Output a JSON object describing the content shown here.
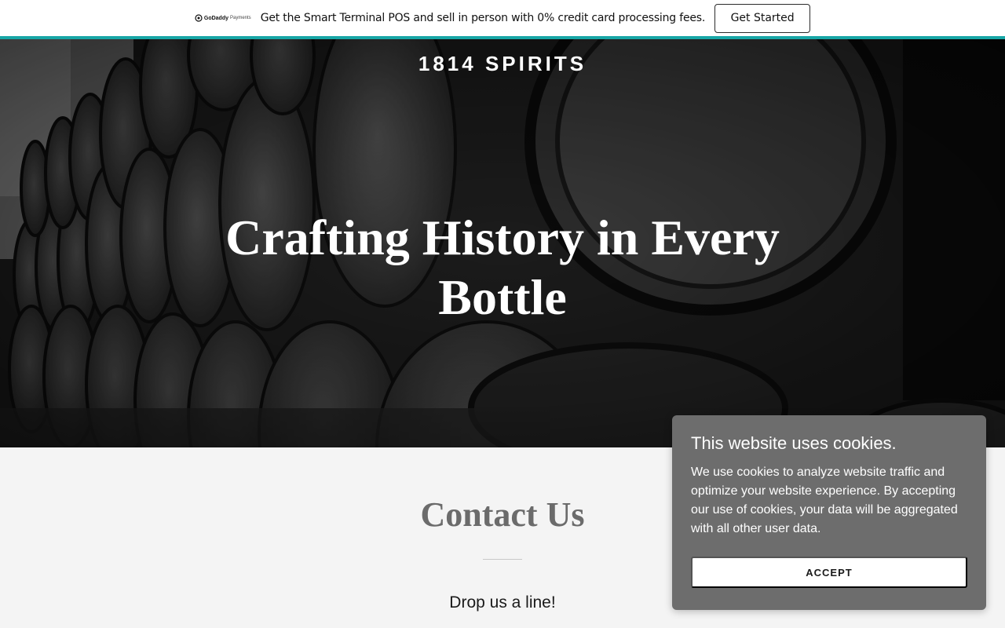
{
  "promo": {
    "logo_text": "GoDaddy",
    "logo_sub": "Payments",
    "message": "Get the Smart Terminal POS and sell in person with 0% credit card processing fees.",
    "cta": "Get Started",
    "accent_color": "#17a6a6"
  },
  "hero": {
    "brand": "1814 SPIRITS",
    "headline": "Crafting History in Every Bottle"
  },
  "contact": {
    "title": "Contact Us",
    "subtitle": "Drop us a line!"
  },
  "cookie": {
    "title": "This website uses cookies.",
    "body": "We use cookies to analyze website traffic and optimize your website experience. By accepting our use of cookies, your data will be aggregated with all other user data.",
    "accept": "ACCEPT"
  }
}
